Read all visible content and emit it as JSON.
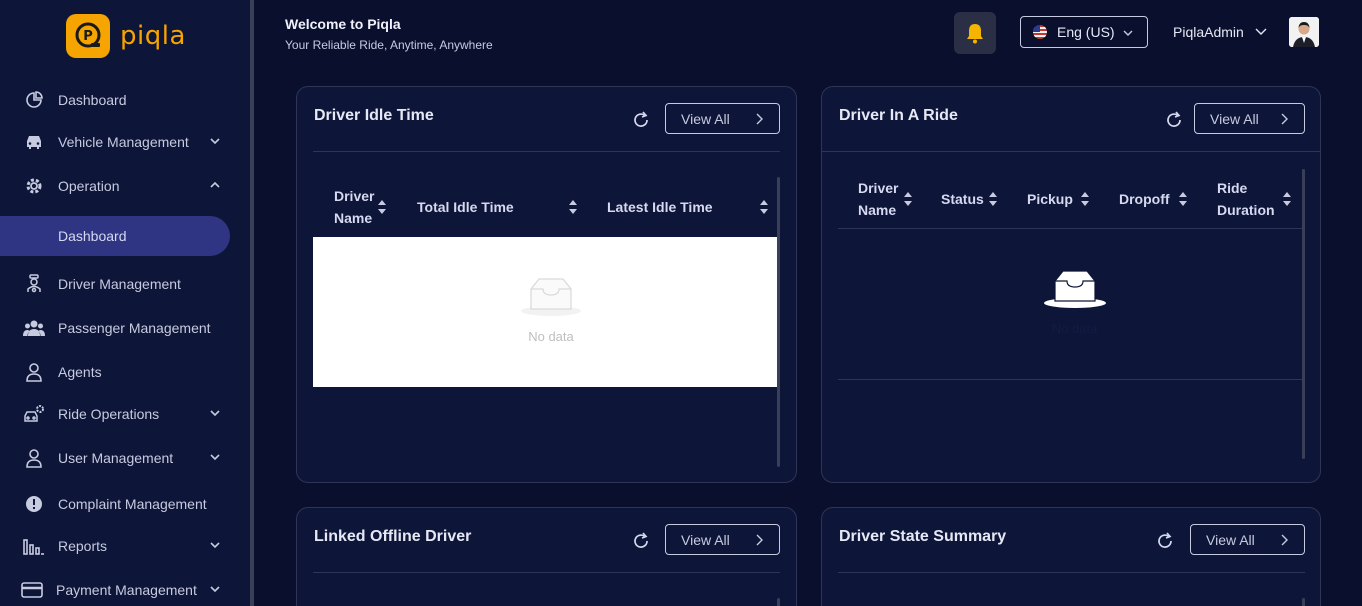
{
  "brand": {
    "name": "piqla",
    "accent": "#f5a400"
  },
  "sidebar": {
    "items": [
      {
        "label": "Dashboard",
        "icon": "pie-chart-icon"
      },
      {
        "label": "Vehicle Management",
        "icon": "car-icon",
        "expandable": true
      },
      {
        "label": "Operation",
        "icon": "gear-icon",
        "expanded": true
      },
      {
        "label": "Dashboard",
        "icon": "none",
        "active": true
      },
      {
        "label": "Driver Management",
        "icon": "driver-icon"
      },
      {
        "label": "Passenger Management",
        "icon": "users-icon"
      },
      {
        "label": "Agents",
        "icon": "person-icon"
      },
      {
        "label": "Ride Operations",
        "icon": "car-gear-icon",
        "expandable": true
      },
      {
        "label": "User Management",
        "icon": "person-icon",
        "expandable": true
      },
      {
        "label": "Complaint Management",
        "icon": "alert-icon"
      },
      {
        "label": "Reports",
        "icon": "bar-chart-icon",
        "expandable": true
      },
      {
        "label": "Payment Management",
        "icon": "card-icon",
        "expandable": true
      }
    ]
  },
  "header": {
    "title": "Welcome to Piqla",
    "subtitle": "Your Reliable Ride, Anytime, Anywhere",
    "language": "Eng (US)",
    "username": "PiqlaAdmin"
  },
  "cards": {
    "idle": {
      "title": "Driver Idle Time",
      "view_all": "View All",
      "columns": [
        "Driver Name",
        "Total Idle Time",
        "Latest Idle Time"
      ],
      "empty": "No data"
    },
    "ride": {
      "title": "Driver In A Ride",
      "view_all": "View All",
      "columns": [
        "Driver Name",
        "Status",
        "Pickup",
        "Dropoff",
        "Ride Duration"
      ],
      "empty": "No data"
    },
    "offline": {
      "title": "Linked Offline Driver",
      "view_all": "View All"
    },
    "state": {
      "title": "Driver State Summary",
      "view_all": "View All"
    }
  }
}
